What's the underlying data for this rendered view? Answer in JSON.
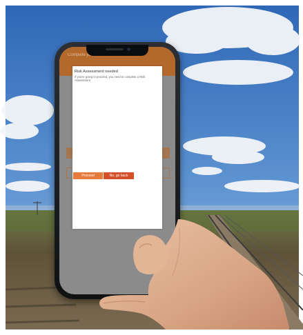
{
  "app": {
    "header_title": "Complete your Risk Assessment after"
  },
  "modal": {
    "title": "Risk Assessment needed",
    "message": "If you're going to proceed, you need to complete a Risk Assessment"
  },
  "buttons": {
    "proceed": "Proceed",
    "go_back": "No, go back"
  },
  "colors": {
    "sky": "#3f78c1",
    "header": "#b4692c",
    "proceed": "#e57a3b",
    "go_back": "#d4502a",
    "ground": "#6b5a45"
  }
}
